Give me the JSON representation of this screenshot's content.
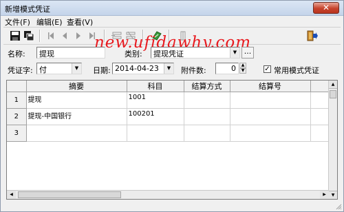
{
  "window": {
    "title": "新增模式凭证",
    "close_glyph": "✕"
  },
  "menu": {
    "items": [
      "文件(F)",
      "编辑(E)",
      "查看(V)"
    ]
  },
  "toolbar": {
    "icons": [
      "save-icon",
      "save-as-icon",
      "first-record-icon",
      "prev-record-icon",
      "next-record-icon",
      "last-record-icon",
      "insert-row-icon",
      "delete-row-icon",
      "notes-icon",
      "column-icon",
      "exit-icon"
    ]
  },
  "form": {
    "name_label": "名称:",
    "name_value": "提现",
    "category_label": "类别:",
    "category_value": "提现凭证",
    "ellipsis_label": "...",
    "voucher_label": "凭证字:",
    "voucher_value": "付",
    "date_label": "日期:",
    "date_value": "2014-04-23",
    "attachments_label": "附件数:",
    "attachments_value": "0",
    "common_label": "常用模式凭证",
    "common_checked": true
  },
  "grid": {
    "columns": [
      "摘要",
      "科目",
      "结算方式",
      "结算号"
    ],
    "rows": [
      {
        "no": "1",
        "summary": "提现",
        "account": "1001",
        "settle_method": "",
        "settle_no": ""
      },
      {
        "no": "2",
        "summary": "提现-中国银行",
        "account": "100201",
        "settle_method": "",
        "settle_no": ""
      },
      {
        "no": "3",
        "summary": "",
        "account": "",
        "settle_method": "",
        "settle_no": ""
      }
    ]
  },
  "watermark": "new.ufidawhy.com"
}
